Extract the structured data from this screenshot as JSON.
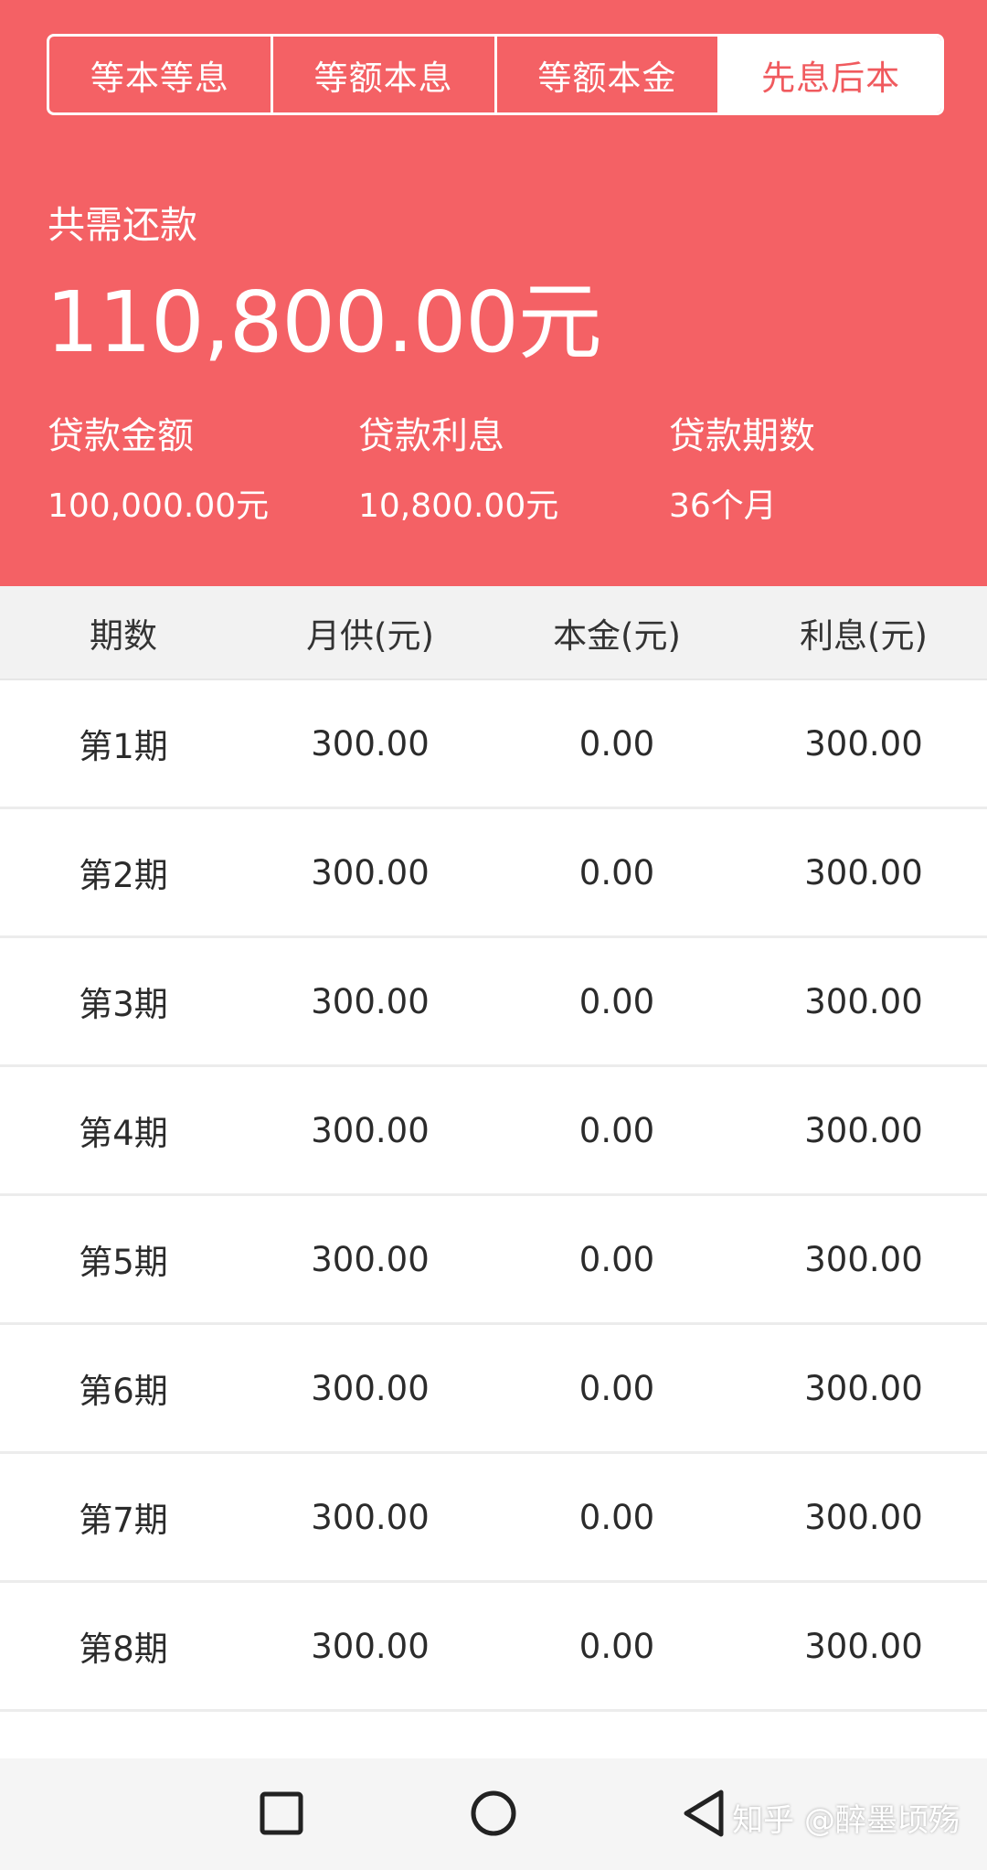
{
  "tabs": [
    {
      "label": "等本等息",
      "active": false
    },
    {
      "label": "等额本息",
      "active": false
    },
    {
      "label": "等额本金",
      "active": false
    },
    {
      "label": "先息后本",
      "active": true
    }
  ],
  "summary": {
    "total_label": "共需还款",
    "total_amount": "110,800.00元",
    "stats": [
      {
        "label": "贷款金额",
        "value": "100,000.00元"
      },
      {
        "label": "贷款利息",
        "value": "10,800.00元"
      },
      {
        "label": "贷款期数",
        "value": "36个月"
      }
    ]
  },
  "table": {
    "headers": [
      "期数",
      "月供(元)",
      "本金(元)",
      "利息(元)"
    ],
    "rows": [
      [
        "第1期",
        "300.00",
        "0.00",
        "300.00"
      ],
      [
        "第2期",
        "300.00",
        "0.00",
        "300.00"
      ],
      [
        "第3期",
        "300.00",
        "0.00",
        "300.00"
      ],
      [
        "第4期",
        "300.00",
        "0.00",
        "300.00"
      ],
      [
        "第5期",
        "300.00",
        "0.00",
        "300.00"
      ],
      [
        "第6期",
        "300.00",
        "0.00",
        "300.00"
      ],
      [
        "第7期",
        "300.00",
        "0.00",
        "300.00"
      ],
      [
        "第8期",
        "300.00",
        "0.00",
        "300.00"
      ]
    ]
  },
  "navbar": {
    "icons": [
      "square-recents-icon",
      "circle-home-icon",
      "triangle-back-icon"
    ],
    "watermark": "知乎 @醉墨顷殇"
  },
  "colors": {
    "header_bg": "#f46165",
    "active_tab_text": "#f05a5e",
    "table_head_bg": "#f2f2f2"
  }
}
